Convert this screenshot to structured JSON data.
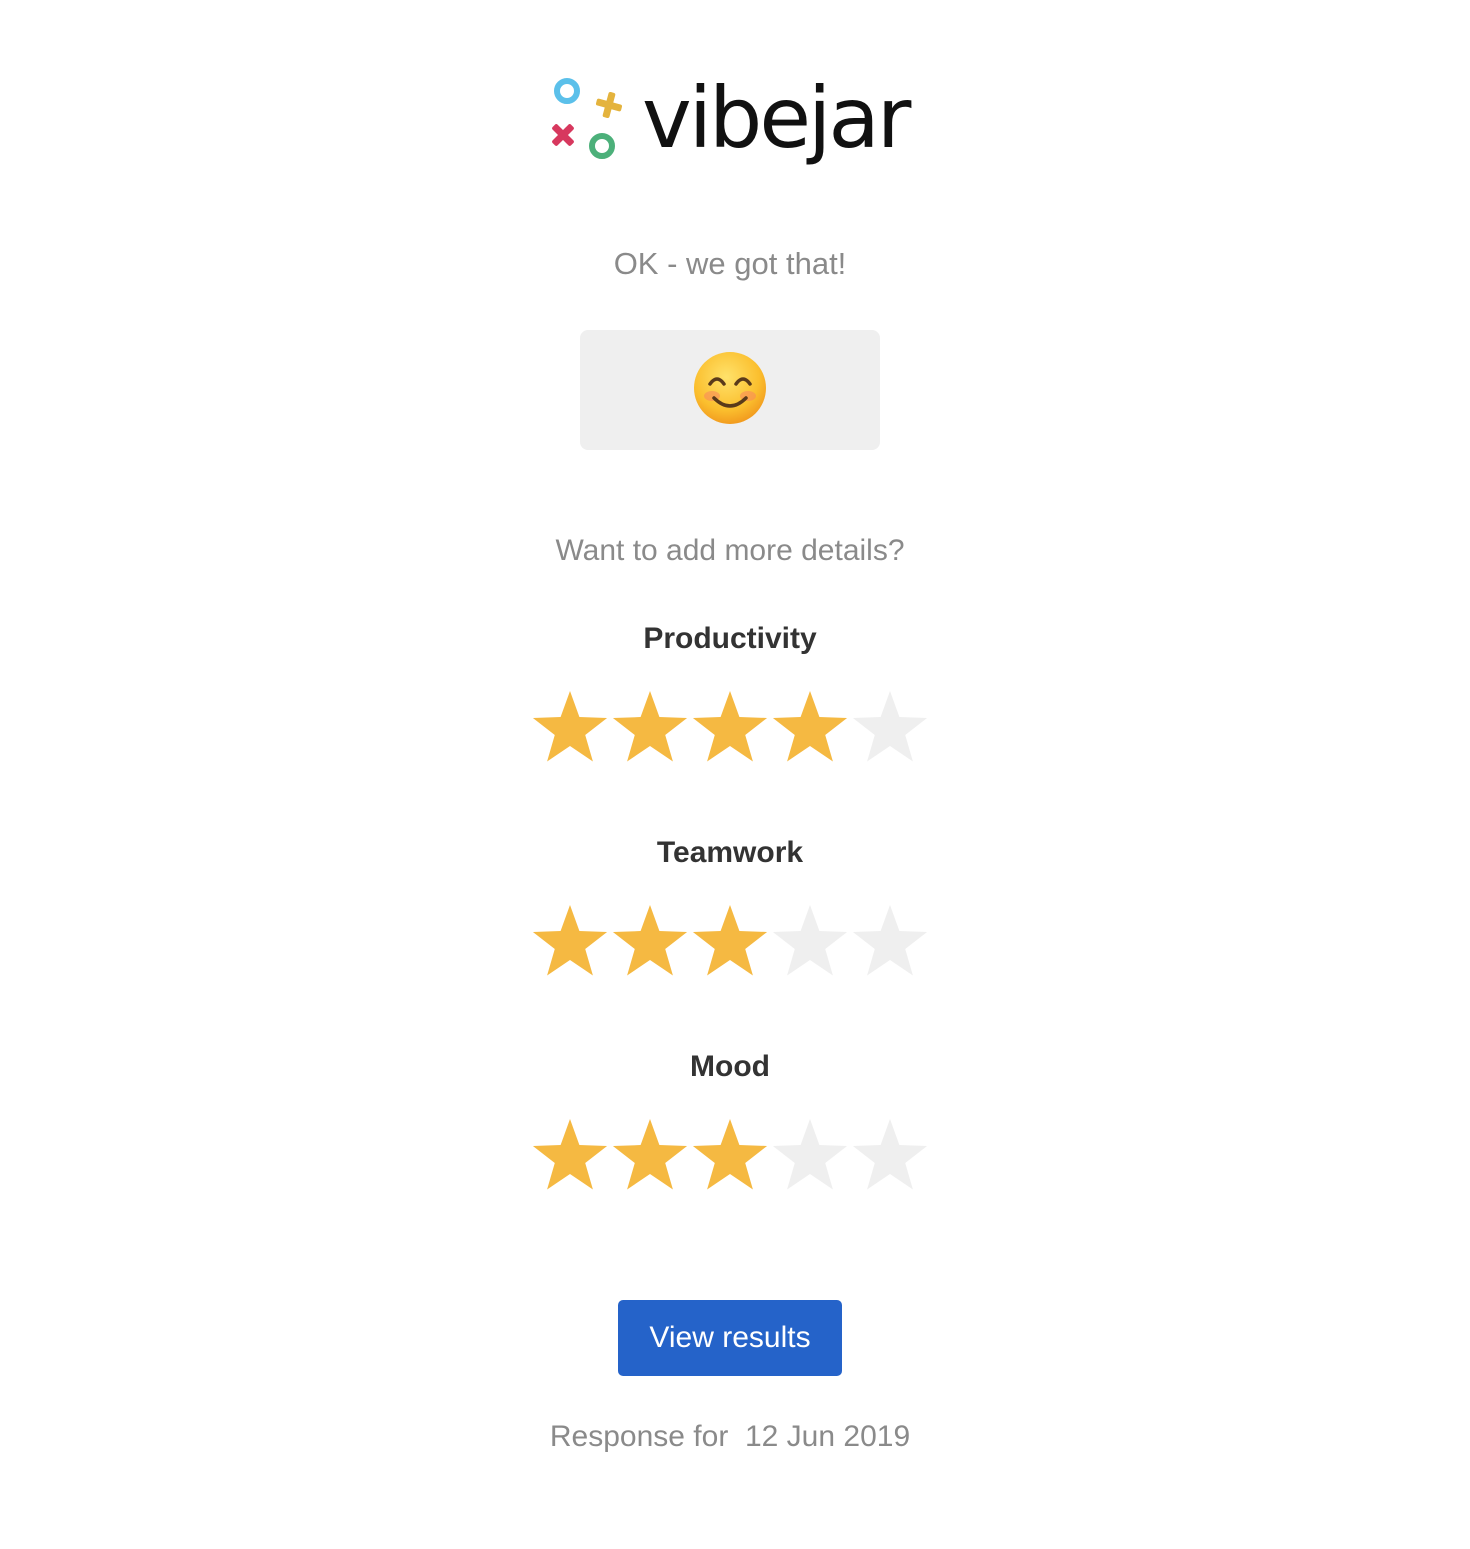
{
  "brand": {
    "name": "vibejar",
    "logo_icon": "vibejar-logo-icon",
    "colors": {
      "blue": "#5bc0ea",
      "gold": "#e4b33d",
      "red": "#d7385e",
      "green": "#4cb07a"
    }
  },
  "confirmation": {
    "headline": "OK - we got that!",
    "selected_mood_icon": "smiling-face-icon"
  },
  "details": {
    "prompt": "Want to add more details?",
    "max_rating": 5,
    "star_filled_color": "#f5b942",
    "star_empty_color": "#efefef",
    "categories": [
      {
        "label": "Productivity",
        "rating": 4
      },
      {
        "label": "Teamwork",
        "rating": 3
      },
      {
        "label": "Mood",
        "rating": 3
      }
    ]
  },
  "actions": {
    "view_results_label": "View results",
    "button_color": "#2563c9"
  },
  "footer": {
    "response_text": "Response for  12 Jun 2019"
  }
}
